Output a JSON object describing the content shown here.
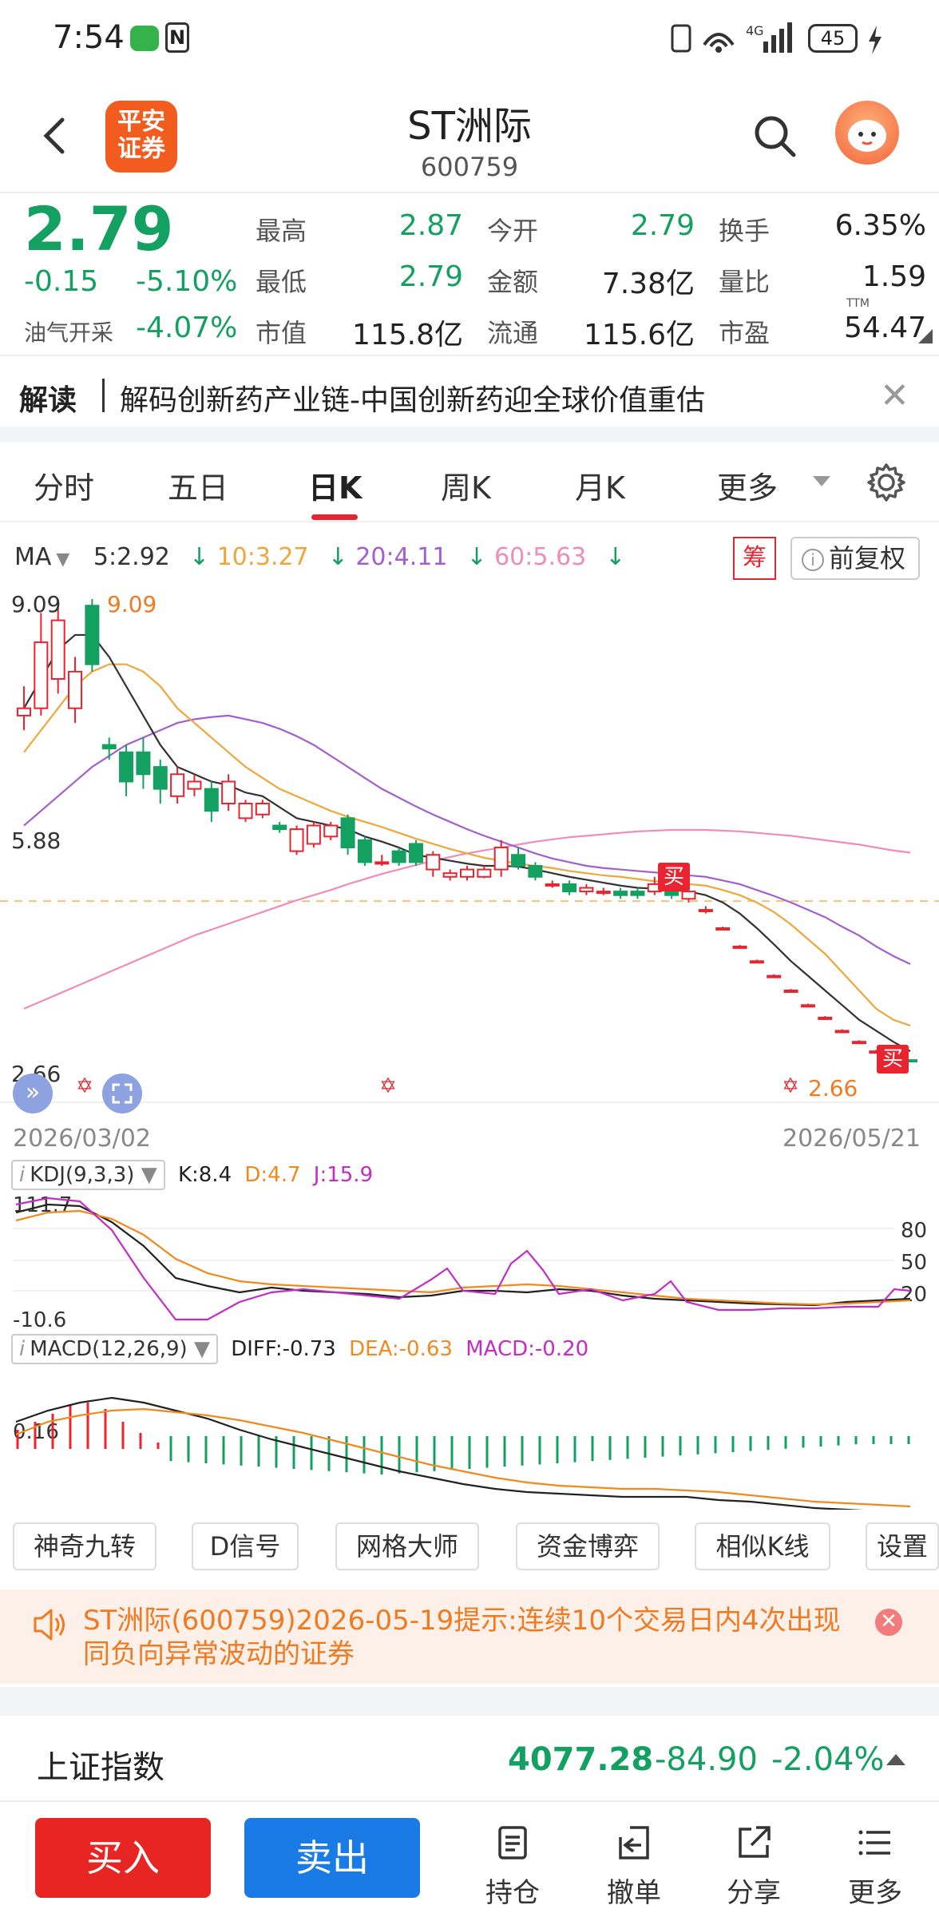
{
  "status": {
    "time": "7:54",
    "battery": "45",
    "network": "4G"
  },
  "header": {
    "back_label": "返回",
    "logo_text": "平安证券",
    "title": "ST洲际",
    "code": "600759"
  },
  "quote": {
    "price": "2.79",
    "change": "-0.15",
    "change_pct": "-5.10%",
    "sector_label": "油气开采",
    "sector_pct": "-4.07%",
    "cells": [
      {
        "label": "最高",
        "value": "2.87",
        "color": "green"
      },
      {
        "label": "今开",
        "value": "2.79",
        "color": "green"
      },
      {
        "label": "换手",
        "value": "6.35%",
        "color": "dark"
      },
      {
        "label": "最低",
        "value": "2.79",
        "color": "green"
      },
      {
        "label": "金额",
        "value": "7.38亿",
        "color": "dark"
      },
      {
        "label": "量比",
        "value": "1.59",
        "color": "dark"
      },
      {
        "label": "市值",
        "value": "115.8亿",
        "color": "dark"
      },
      {
        "label": "流通",
        "value": "115.6亿",
        "color": "dark"
      },
      {
        "label": "市盈",
        "value": "54.47",
        "color": "dark"
      }
    ],
    "pe_suffix": "TTM"
  },
  "news": {
    "label": "解读",
    "text": "解码创新药产业链-中国创新药迎全球价值重估"
  },
  "tabs": [
    "分时",
    "五日",
    "日K",
    "周K",
    "月K",
    "更多"
  ],
  "active_tab": "日K",
  "ma": {
    "label": "MA",
    "items": [
      {
        "text": "5:2.92",
        "color": "#333333"
      },
      {
        "text": "10:3.27",
        "color": "#f0a63a"
      },
      {
        "text": "20:4.11",
        "color": "#a35fce"
      },
      {
        "text": "60:5.63",
        "color": "#f08cb8"
      }
    ],
    "chou": "筹",
    "fuquan": "前复权"
  },
  "chart_data": {
    "type": "candlestick",
    "date_start": "2026/03/02",
    "date_end": "2026/05/21",
    "y_high_label": "9.09",
    "y_mid_label": "5.88",
    "y_low_label": "2.66",
    "max_marker": "9.09",
    "min_marker": "2.66",
    "buy_marker": "买",
    "colors": {
      "up": "#e7242f",
      "down": "#13a061",
      "ma5": "#333333",
      "ma10": "#f0a63a",
      "ma20": "#a35fce",
      "ma60": "#f08cb8"
    },
    "ylim": [
      2.66,
      9.09
    ],
    "candles": [
      {
        "o": 7.5,
        "c": 7.6,
        "h": 7.9,
        "l": 7.3
      },
      {
        "o": 7.6,
        "c": 8.5,
        "h": 8.9,
        "l": 7.5
      },
      {
        "o": 8.0,
        "c": 8.8,
        "h": 9.09,
        "l": 7.8
      },
      {
        "o": 7.6,
        "c": 8.1,
        "h": 8.3,
        "l": 7.4
      },
      {
        "o": 9.0,
        "c": 8.2,
        "h": 9.09,
        "l": 8.1
      },
      {
        "o": 7.1,
        "c": 7.05,
        "h": 7.2,
        "l": 6.9
      },
      {
        "o": 7.0,
        "c": 6.6,
        "h": 7.1,
        "l": 6.4
      },
      {
        "o": 7.0,
        "c": 6.7,
        "h": 7.2,
        "l": 6.5
      },
      {
        "o": 6.8,
        "c": 6.5,
        "h": 6.9,
        "l": 6.3
      },
      {
        "o": 6.4,
        "c": 6.7,
        "h": 6.8,
        "l": 6.3
      },
      {
        "o": 6.5,
        "c": 6.6,
        "h": 6.7,
        "l": 6.4
      },
      {
        "o": 6.5,
        "c": 6.2,
        "h": 6.6,
        "l": 6.05
      },
      {
        "o": 6.3,
        "c": 6.6,
        "h": 6.7,
        "l": 6.2
      },
      {
        "o": 6.1,
        "c": 6.3,
        "h": 6.35,
        "l": 6.05
      },
      {
        "o": 6.15,
        "c": 6.3,
        "h": 6.35,
        "l": 6.1
      },
      {
        "o": 6.0,
        "c": 5.95,
        "h": 6.05,
        "l": 5.9
      },
      {
        "o": 5.65,
        "c": 5.95,
        "h": 6.0,
        "l": 5.6
      },
      {
        "o": 5.75,
        "c": 6.0,
        "h": 6.05,
        "l": 5.7
      },
      {
        "o": 5.85,
        "c": 6.0,
        "h": 6.05,
        "l": 5.8
      },
      {
        "o": 6.1,
        "c": 5.7,
        "h": 6.15,
        "l": 5.6
      },
      {
        "o": 5.8,
        "c": 5.5,
        "h": 5.85,
        "l": 5.45
      },
      {
        "o": 5.48,
        "c": 5.5,
        "h": 5.6,
        "l": 5.45
      },
      {
        "o": 5.65,
        "c": 5.5,
        "h": 5.7,
        "l": 5.45
      },
      {
        "o": 5.75,
        "c": 5.5,
        "h": 5.8,
        "l": 5.45
      },
      {
        "o": 5.4,
        "c": 5.6,
        "h": 5.65,
        "l": 5.3
      },
      {
        "o": 5.3,
        "c": 5.35,
        "h": 5.4,
        "l": 5.25
      },
      {
        "o": 5.3,
        "c": 5.4,
        "h": 5.45,
        "l": 5.25
      },
      {
        "o": 5.3,
        "c": 5.4,
        "h": 5.45,
        "l": 5.28
      },
      {
        "o": 5.4,
        "c": 5.7,
        "h": 5.8,
        "l": 5.3
      },
      {
        "o": 5.6,
        "c": 5.45,
        "h": 5.7,
        "l": 5.4
      },
      {
        "o": 5.45,
        "c": 5.3,
        "h": 5.5,
        "l": 5.25
      },
      {
        "o": 5.2,
        "c": 5.2,
        "h": 5.25,
        "l": 5.15
      },
      {
        "o": 5.2,
        "c": 5.1,
        "h": 5.25,
        "l": 5.05
      },
      {
        "o": 5.1,
        "c": 5.15,
        "h": 5.2,
        "l": 5.05
      },
      {
        "o": 5.1,
        "c": 5.1,
        "h": 5.15,
        "l": 5.05
      },
      {
        "o": 5.1,
        "c": 5.05,
        "h": 5.15,
        "l": 5.0
      },
      {
        "o": 5.1,
        "c": 5.05,
        "h": 5.15,
        "l": 5.0
      },
      {
        "o": 5.1,
        "c": 5.2,
        "h": 5.3,
        "l": 5.05
      },
      {
        "o": 5.15,
        "c": 5.05,
        "h": 5.2,
        "l": 5.0
      },
      {
        "o": 5.0,
        "c": 5.1,
        "h": 5.15,
        "l": 4.95
      },
      {
        "o": 4.85,
        "c": 4.85,
        "h": 4.9,
        "l": 4.8
      },
      {
        "o": 4.6,
        "c": 4.6,
        "h": 4.62,
        "l": 4.58
      },
      {
        "o": 4.35,
        "c": 4.35,
        "h": 4.37,
        "l": 4.33
      },
      {
        "o": 4.15,
        "c": 4.15,
        "h": 4.17,
        "l": 4.13
      },
      {
        "o": 3.95,
        "c": 3.95,
        "h": 3.97,
        "l": 3.93
      },
      {
        "o": 3.75,
        "c": 3.75,
        "h": 3.77,
        "l": 3.73
      },
      {
        "o": 3.55,
        "c": 3.55,
        "h": 3.57,
        "l": 3.53
      },
      {
        "o": 3.38,
        "c": 3.38,
        "h": 3.4,
        "l": 3.36
      },
      {
        "o": 3.2,
        "c": 3.2,
        "h": 3.22,
        "l": 3.18
      },
      {
        "o": 3.05,
        "c": 3.05,
        "h": 3.07,
        "l": 3.03
      },
      {
        "o": 2.92,
        "c": 2.92,
        "h": 2.94,
        "l": 2.9
      },
      {
        "o": 2.66,
        "c": 2.79,
        "h": 2.87,
        "l": 2.66
      },
      {
        "o": 2.8,
        "c": 2.79,
        "h": 2.81,
        "l": 2.78
      }
    ],
    "ma5": [
      7.6,
      8.0,
      8.4,
      8.6,
      8.6,
      8.3,
      7.9,
      7.5,
      7.1,
      6.8,
      6.7,
      6.6,
      6.55,
      6.45,
      6.4,
      6.25,
      6.1,
      6.05,
      6.0,
      5.95,
      5.85,
      5.78,
      5.7,
      5.6,
      5.56,
      5.52,
      5.48,
      5.45,
      5.45,
      5.44,
      5.4,
      5.35,
      5.3,
      5.26,
      5.22,
      5.18,
      5.15,
      5.14,
      5.12,
      5.1,
      5.05,
      4.95,
      4.8,
      4.6,
      4.38,
      4.15,
      3.95,
      3.75,
      3.55,
      3.35,
      3.2,
      3.05,
      2.92
    ],
    "ma10": [
      7.0,
      7.3,
      7.6,
      7.9,
      8.1,
      8.2,
      8.2,
      8.1,
      7.9,
      7.6,
      7.4,
      7.2,
      7.0,
      6.8,
      6.65,
      6.5,
      6.4,
      6.3,
      6.2,
      6.12,
      6.05,
      5.98,
      5.9,
      5.82,
      5.75,
      5.68,
      5.62,
      5.56,
      5.52,
      5.48,
      5.45,
      5.42,
      5.38,
      5.35,
      5.32,
      5.3,
      5.27,
      5.24,
      5.22,
      5.2,
      5.18,
      5.12,
      5.05,
      4.95,
      4.82,
      4.65,
      4.45,
      4.25,
      4.0,
      3.75,
      3.5,
      3.35,
      3.27
    ],
    "ma20": [
      6.0,
      6.2,
      6.4,
      6.6,
      6.8,
      6.95,
      7.1,
      7.2,
      7.3,
      7.4,
      7.45,
      7.48,
      7.5,
      7.45,
      7.4,
      7.32,
      7.22,
      7.1,
      6.95,
      6.8,
      6.65,
      6.5,
      6.38,
      6.26,
      6.15,
      6.05,
      5.95,
      5.86,
      5.78,
      5.7,
      5.62,
      5.55,
      5.5,
      5.45,
      5.42,
      5.4,
      5.38,
      5.36,
      5.34,
      5.32,
      5.3,
      5.25,
      5.2,
      5.12,
      5.04,
      4.95,
      4.85,
      4.75,
      4.62,
      4.5,
      4.35,
      4.22,
      4.11
    ],
    "ma60": [
      3.5,
      3.6,
      3.7,
      3.8,
      3.9,
      4.0,
      4.1,
      4.2,
      4.3,
      4.4,
      4.5,
      4.58,
      4.66,
      4.74,
      4.82,
      4.9,
      4.98,
      5.05,
      5.12,
      5.2,
      5.27,
      5.34,
      5.4,
      5.46,
      5.52,
      5.57,
      5.62,
      5.66,
      5.7,
      5.74,
      5.78,
      5.81,
      5.84,
      5.86,
      5.88,
      5.9,
      5.92,
      5.93,
      5.94,
      5.94,
      5.94,
      5.93,
      5.92,
      5.9,
      5.88,
      5.86,
      5.83,
      5.8,
      5.77,
      5.74,
      5.7,
      5.66,
      5.63
    ],
    "kdj": {
      "label": "KDJ(9,3,3)",
      "k_text": "K:8.4",
      "d_text": "D:4.7",
      "j_text": "J:15.9",
      "y_top_label": "111.7",
      "y_bottom_label": "-10.6",
      "ticks": [
        "80",
        "50",
        "20"
      ],
      "ylim": [
        -10.6,
        111.7
      ]
    },
    "macd": {
      "label": "MACD(12,26,9)",
      "diff_text": "DIFF:-0.73",
      "dea_text": "DEA:-0.63",
      "macd_text": "MACD:-0.20",
      "y_label": "0.16"
    }
  },
  "tools": [
    "神奇九转",
    "D信号",
    "网格大师",
    "资金博弈",
    "相似K线",
    "设置"
  ],
  "notice": {
    "text": "ST洲际(600759)2026-05-19提示:连续10个交易日内4次出现同负向异常波动的证券"
  },
  "index": {
    "name": "上证指数",
    "value": "4077.28",
    "change": "-84.90",
    "pct": "-2.04%"
  },
  "bottom": {
    "buy": "买入",
    "sell": "卖出",
    "nav": [
      "持仓",
      "撤单",
      "分享",
      "更多"
    ]
  }
}
